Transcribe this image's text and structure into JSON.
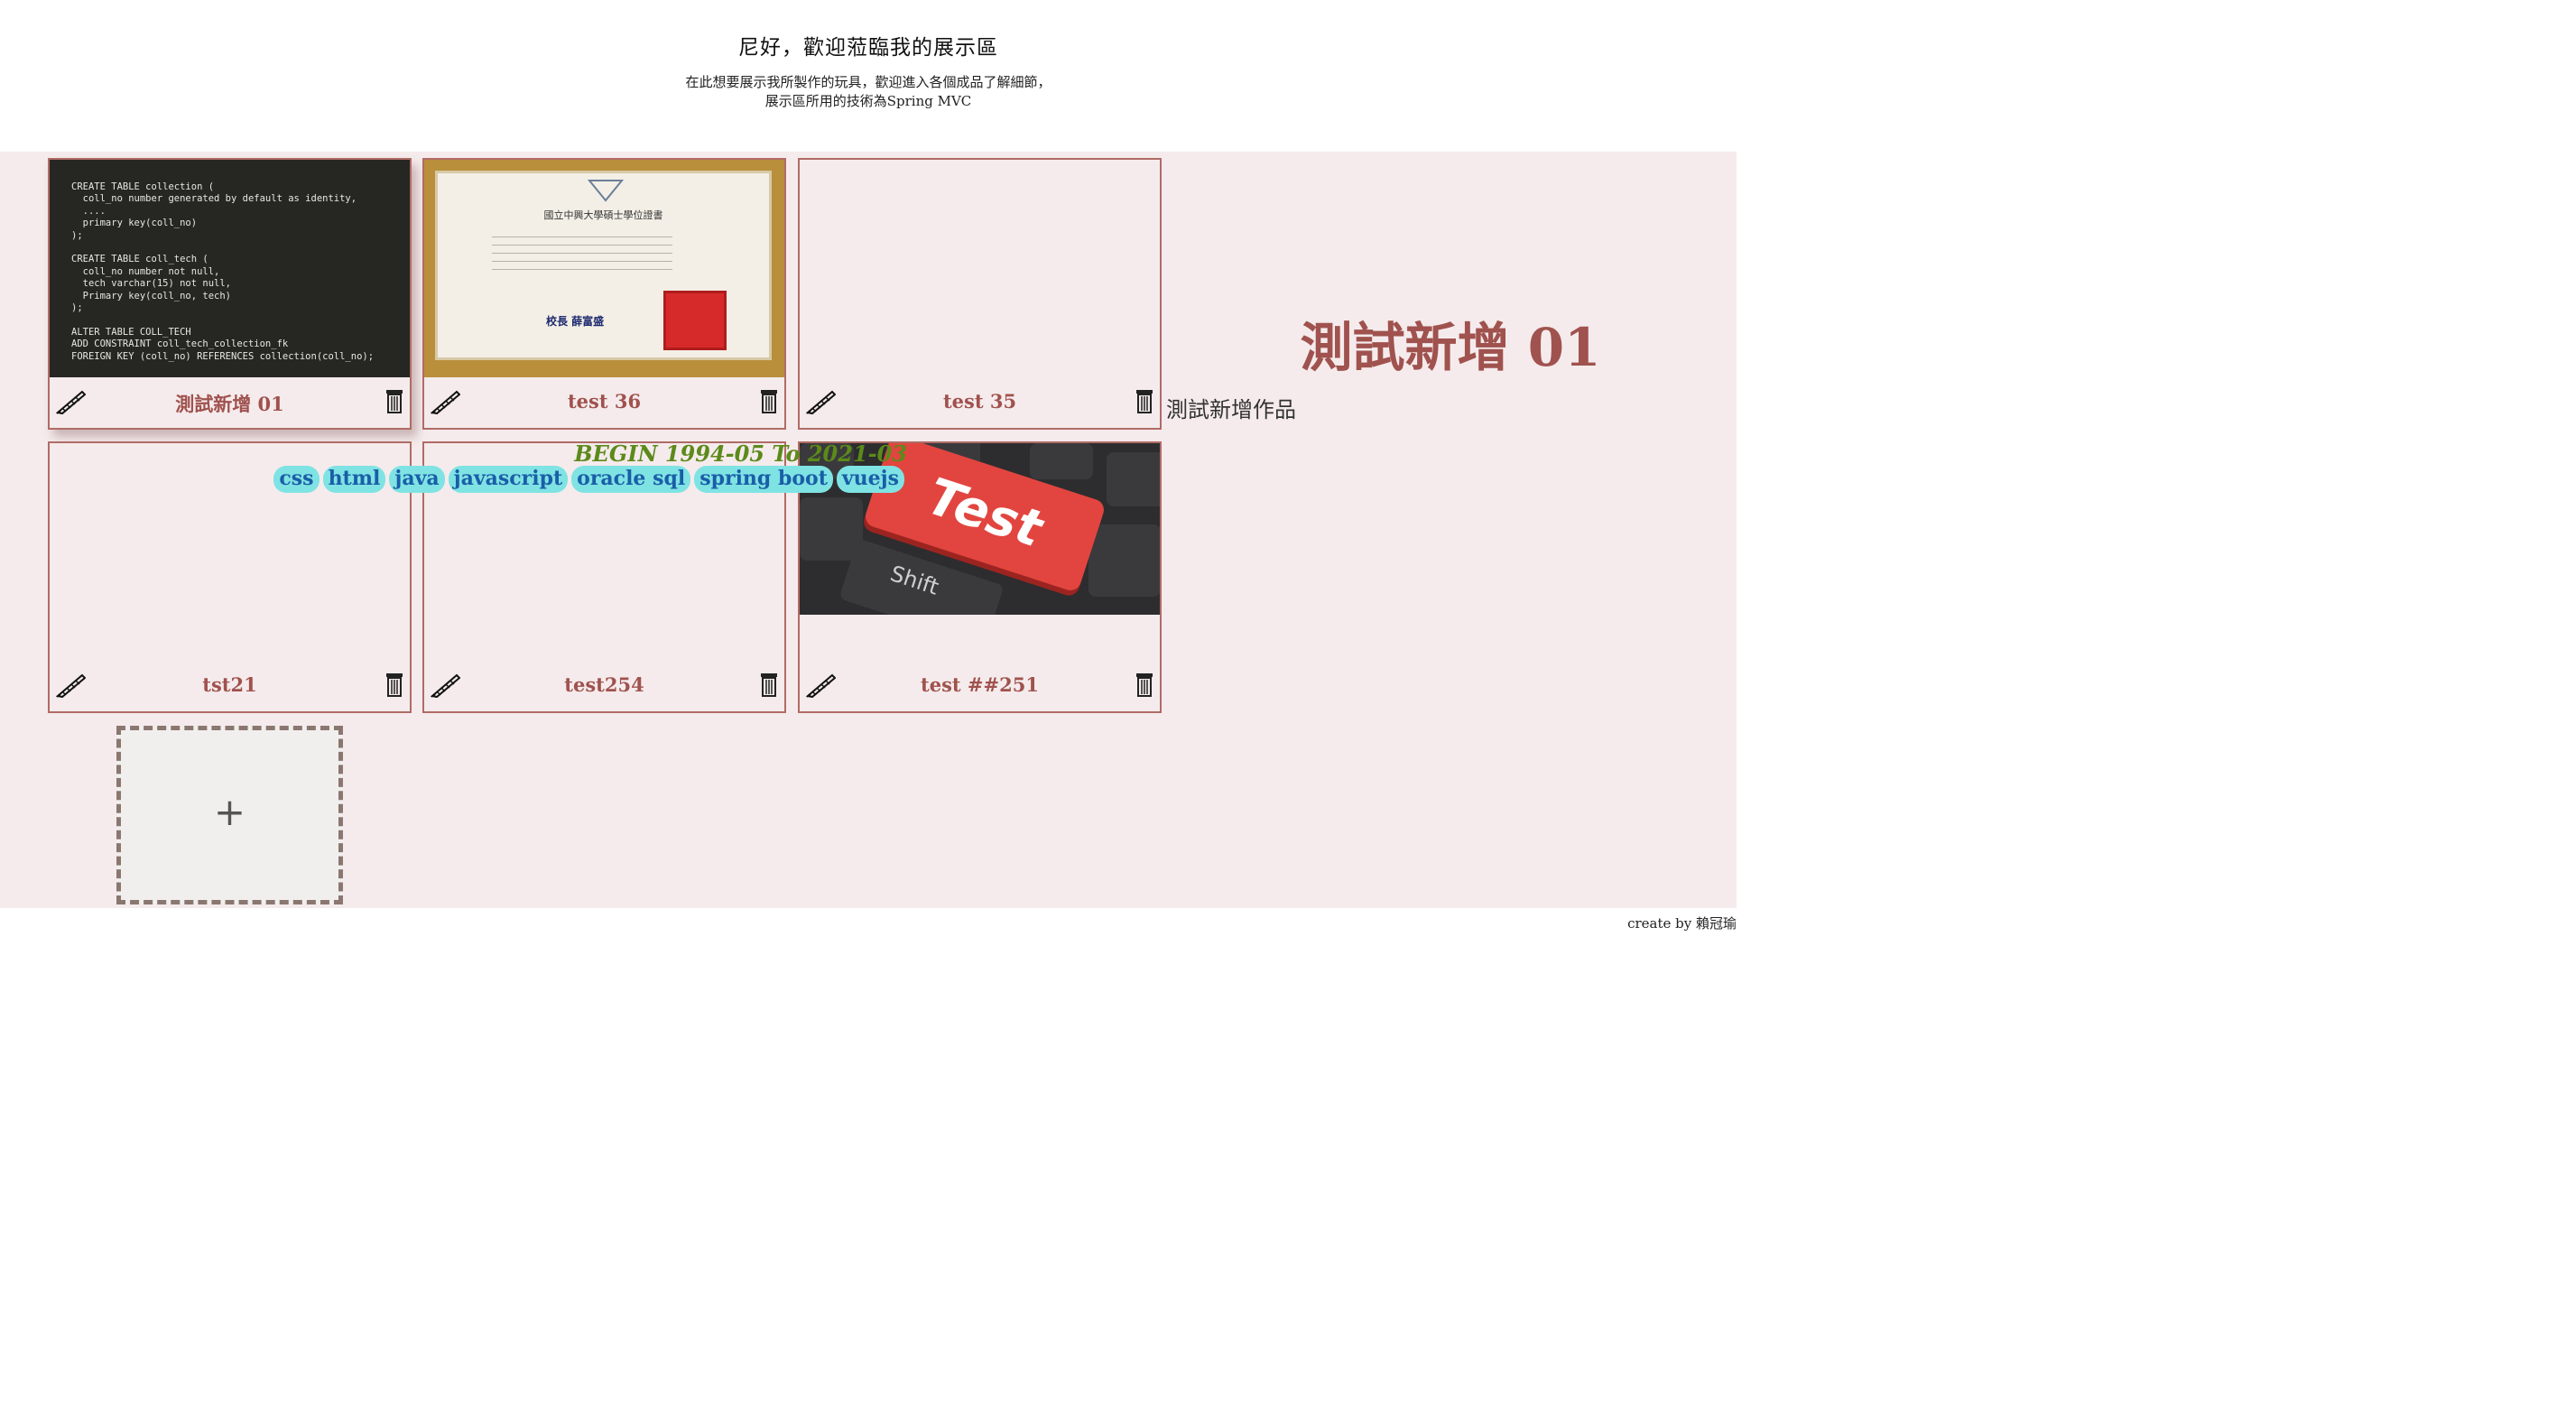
{
  "header": {
    "title": "尼好，歡迎蒞臨我的展示區",
    "intro_line1": "在此想要展示我所製作的玩具，歡迎進入各個成品了解細節，",
    "intro_line2": "展示區所用的技術為Spring MVC"
  },
  "cards": [
    {
      "title": "測試新增 01",
      "thumb": "sql-code",
      "code_lines": [
        "CREATE TABLE collection (",
        "  coll_no number generated by default as identity,",
        "  ....",
        "  primary key(coll_no)",
        ");",
        "",
        "CREATE TABLE coll_tech (",
        "  coll_no number not null,",
        "  tech varchar(15) not null,",
        "  Primary key(coll_no, tech)",
        ");",
        "",
        "ALTER TABLE COLL_TECH",
        "ADD CONSTRAINT coll_tech_collection_fk",
        "FOREIGN KEY (coll_no) REFERENCES collection(coll_no);"
      ]
    },
    {
      "title": "test 36",
      "thumb": "certificate",
      "cert_heading": "國立中興大學碩士學位證書",
      "cert_signer": "校長 薛富盛"
    },
    {
      "title": "test 35",
      "thumb": "empty"
    },
    {
      "title": "tst21",
      "thumb": "empty"
    },
    {
      "title": "test254",
      "thumb": "empty"
    },
    {
      "title": "test ##251",
      "thumb": "keyboard",
      "key_label": "Test",
      "shift_label": "Shift"
    }
  ],
  "add_button": {
    "label": "+"
  },
  "detail": {
    "title": "測試新增 01",
    "description": "測試新增作品",
    "dates": "BEGIN 1994-05 To 2021-03",
    "tags": [
      "css",
      "html",
      "java",
      "javascript",
      "oracle sql",
      "spring boot",
      "vuejs"
    ]
  },
  "footer": {
    "credit": "create by 賴冠瑜"
  },
  "colors": {
    "accent": "#a0524e",
    "panel_bg": "#f5ebec",
    "tag_bg": "#7fe3e3",
    "tag_text": "#1a5ea8",
    "date_text": "#5b8a1a"
  },
  "icons": {
    "edit": "quill-pen-icon",
    "delete": "trash-can-icon",
    "add": "plus-icon"
  }
}
